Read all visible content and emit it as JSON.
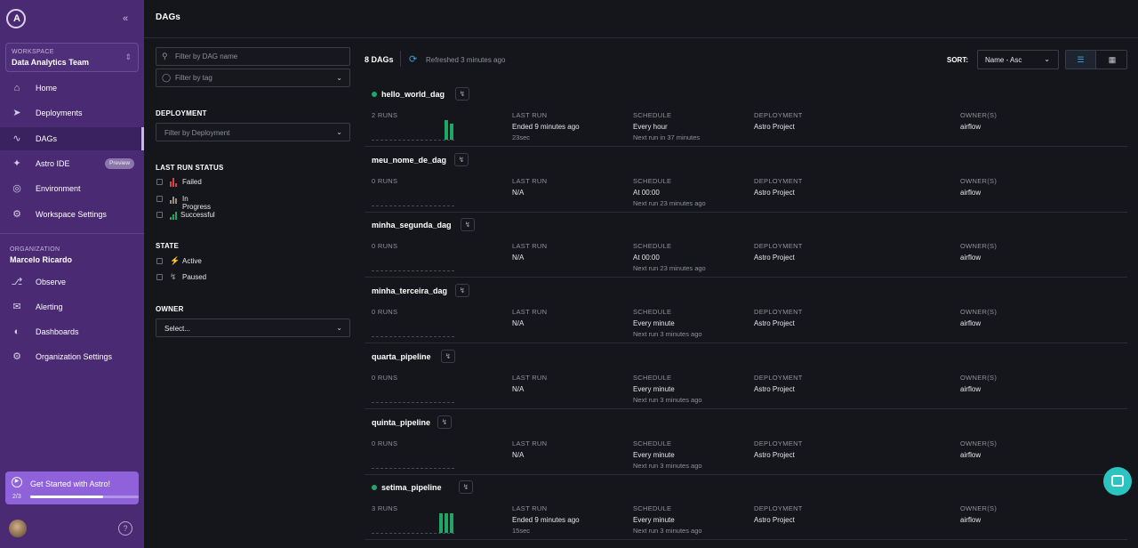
{
  "sidebar": {
    "workspace_label": "WORKSPACE",
    "workspace_name": "Data Analytics Team",
    "nav": [
      {
        "label": "Home",
        "icon": "home-icon"
      },
      {
        "label": "Deployments",
        "icon": "rocket-icon"
      },
      {
        "label": "DAGs",
        "icon": "dags-icon"
      },
      {
        "label": "Astro IDE",
        "icon": "sparkle-icon",
        "badge": "Preview"
      },
      {
        "label": "Environment",
        "icon": "globe-icon"
      },
      {
        "label": "Workspace Settings",
        "icon": "gear-icon"
      }
    ],
    "org_label": "ORGANIZATION",
    "org_name": "Marcelo Ricardo",
    "org_nav": [
      {
        "label": "Observe",
        "icon": "telescope-icon"
      },
      {
        "label": "Alerting",
        "icon": "megaphone-icon"
      },
      {
        "label": "Dashboards",
        "icon": "dashboard-icon"
      },
      {
        "label": "Organization Settings",
        "icon": "gear-icon"
      }
    ],
    "get_started": {
      "label": "Get Started with Astro!",
      "progress_text": "2/3",
      "progress": 0.67
    },
    "help": "?"
  },
  "header": {
    "title": "DAGs"
  },
  "filters": {
    "dag_name_placeholder": "Filter by DAG name",
    "tag_placeholder": "Filter by tag",
    "deployment_title": "DEPLOYMENT",
    "deployment_placeholder": "Filter by Deployment",
    "last_run_title": "LAST RUN STATUS",
    "last_run_options": [
      "Failed",
      "In Progress",
      "Successful"
    ],
    "state_title": "STATE",
    "state_options": [
      "Active",
      "Paused"
    ],
    "owner_title": "OWNER",
    "owner_placeholder": "Select..."
  },
  "list": {
    "count": "8 DAGs",
    "refreshed": "Refreshed 3 minutes ago",
    "sort_label": "SORT:",
    "sort_value": "Name - Asc",
    "headers": {
      "last_run": "LAST RUN",
      "schedule": "SCHEDULE",
      "deployment": "DEPLOYMENT",
      "owners": "OWNER(S)"
    },
    "dags": [
      {
        "name": "hello_world_dag",
        "active": true,
        "runs": "2 RUNS",
        "run_bars": [
          1.0,
          0.8
        ],
        "last_run": "Ended 9 minutes ago",
        "duration": "23sec",
        "schedule": "Every hour",
        "next_run": "Next run in 37 minutes",
        "deployment": "Astro Project",
        "owner": "airflow"
      },
      {
        "name": "meu_nome_de_dag",
        "active": false,
        "runs": "0 RUNS",
        "run_bars": [],
        "last_run": "N/A",
        "duration": "",
        "schedule": "At 00:00",
        "next_run": "Next run 23 minutes ago",
        "deployment": "Astro Project",
        "owner": "airflow"
      },
      {
        "name": "minha_segunda_dag",
        "active": false,
        "runs": "0 RUNS",
        "run_bars": [],
        "last_run": "N/A",
        "duration": "",
        "schedule": "At 00:00",
        "next_run": "Next run 23 minutes ago",
        "deployment": "Astro Project",
        "owner": "airflow"
      },
      {
        "name": "minha_terceira_dag",
        "active": false,
        "runs": "0 RUNS",
        "run_bars": [],
        "last_run": "N/A",
        "duration": "",
        "schedule": "Every minute",
        "next_run": "Next run 3 minutes ago",
        "deployment": "Astro Project",
        "owner": "airflow"
      },
      {
        "name": "quarta_pipeline",
        "active": false,
        "runs": "0 RUNS",
        "run_bars": [],
        "last_run": "N/A",
        "duration": "",
        "schedule": "Every minute",
        "next_run": "Next run 3 minutes ago",
        "deployment": "Astro Project",
        "owner": "airflow"
      },
      {
        "name": "quinta_pipeline",
        "active": false,
        "runs": "0 RUNS",
        "run_bars": [],
        "last_run": "N/A",
        "duration": "",
        "schedule": "Every minute",
        "next_run": "Next run 3 minutes ago",
        "deployment": "Astro Project",
        "owner": "airflow"
      },
      {
        "name": "setima_pipeline",
        "active": true,
        "runs": "3 RUNS",
        "run_bars": [
          1.0,
          1.0,
          1.0
        ],
        "last_run": "Ended 9 minutes ago",
        "duration": "15sec",
        "schedule": "Every minute",
        "next_run": "Next run 3 minutes ago",
        "deployment": "Astro Project",
        "owner": "airflow"
      }
    ]
  },
  "colors": {
    "sidebar": "#4a2a72",
    "success": "#1fa765",
    "accent": "#3aa1d2",
    "chat": "#2bc4c0"
  }
}
